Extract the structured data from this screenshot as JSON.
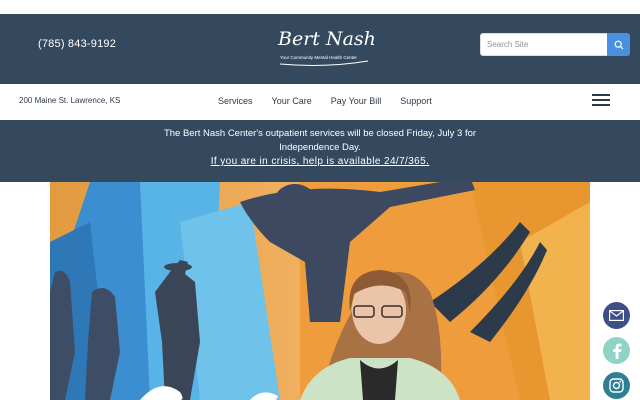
{
  "header": {
    "phone": "(785) 843-9192",
    "logo": {
      "name": "Bert Nash",
      "tagline": "Your Community Mental Health Center"
    },
    "search": {
      "placeholder": "Search Site"
    }
  },
  "nav": {
    "address": "200 Maine St. Lawrence, KS",
    "items": [
      {
        "label": "Services"
      },
      {
        "label": "Your Care"
      },
      {
        "label": "Pay Your Bill"
      },
      {
        "label": "Support"
      }
    ]
  },
  "alert": {
    "message": "The Bert Nash Center's outpatient services will be closed Friday, July 3 for Independence Day.",
    "crisis_link": "If you are in crisis, help is available 24/7/365."
  },
  "social": [
    "email-icon",
    "facebook-icon",
    "instagram-icon"
  ],
  "colors": {
    "header_bg": "#34495e",
    "search_button": "#4a90e2",
    "email": "#3d4f86",
    "facebook": "#8fd3c6",
    "instagram": "#2f7f94"
  }
}
